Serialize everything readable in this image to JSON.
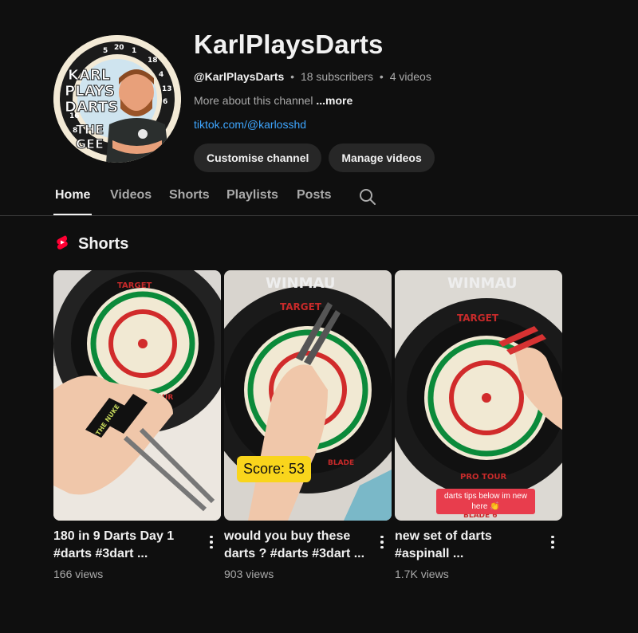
{
  "channel": {
    "name": "KarlPlaysDarts",
    "handle": "@KarlPlaysDarts",
    "subscribers": "18 subscribers",
    "videos": "4 videos",
    "separator": "•",
    "about": "More about this channel",
    "more_label": "...more",
    "link": "tiktok.com/@karlosshd",
    "avatar_text": [
      "KARL",
      "PLAYS",
      "DARTS",
      "THE",
      "GEE"
    ],
    "avatar_numbers": [
      "5",
      "20",
      "1",
      "18",
      "4",
      "13",
      "6",
      "16",
      "8"
    ]
  },
  "actions": {
    "customise_label": "Customise channel",
    "manage_label": "Manage videos"
  },
  "tabs": [
    {
      "label": "Home",
      "active": true
    },
    {
      "label": "Videos"
    },
    {
      "label": "Shorts"
    },
    {
      "label": "Playlists"
    },
    {
      "label": "Posts"
    }
  ],
  "tab_search_icon": "search-icon",
  "shorts_section": {
    "title": "Shorts",
    "icon": "shorts-icon",
    "accent": "#ff0033"
  },
  "shorts": [
    {
      "title": "180 in 9 Darts Day 1 #darts #3dart ...",
      "views": "166 views",
      "thumb_text": [
        "TARGET",
        "PRO TOUR",
        "THE NUKE"
      ]
    },
    {
      "title": "would you buy these darts ? #darts #3dart ...",
      "views": "903 views",
      "thumb_text": [
        "WINMAU",
        "TARGET",
        "BLADE"
      ],
      "overlay": "Score: 53"
    },
    {
      "title": "new set of darts #aspinall ...",
      "views": "1.7K views",
      "thumb_text": [
        "WINMAU",
        "TARGET",
        "PRO TOUR",
        "BLADE 6"
      ],
      "overlay": "darts tips below im new here 👏"
    }
  ],
  "colors": {
    "background": "#0f0f0f",
    "link": "#3ea6ff",
    "button_bg": "#272727",
    "muted_text": "#aaaaaa"
  }
}
